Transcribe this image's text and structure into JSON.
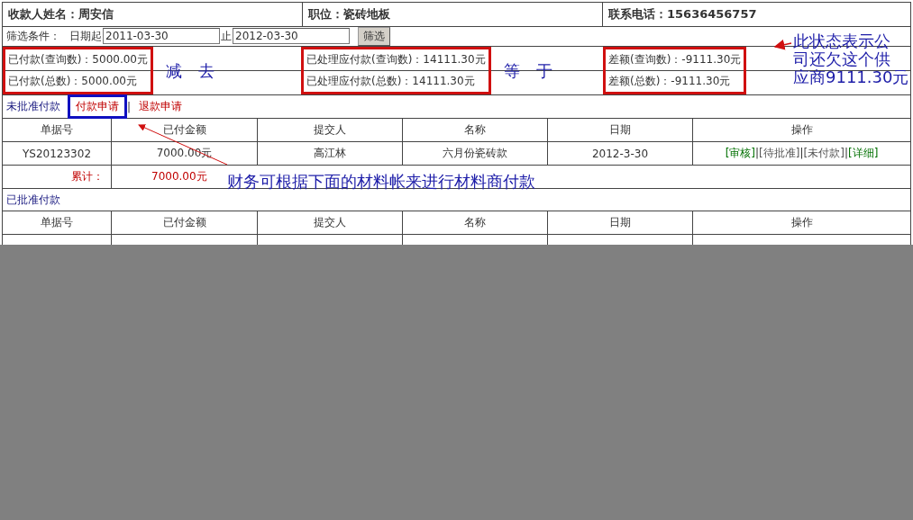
{
  "header": {
    "payee": "收款人姓名：周安信",
    "position": "职位：瓷砖地板",
    "phone": "联系电话：15636456757"
  },
  "filter": {
    "label": "筛选条件：",
    "start_label": "日期起",
    "start_value": "2011-03-30",
    "end_label": "止",
    "end_value": "2012-03-30",
    "button": "筛选"
  },
  "summary": [
    {
      "query": "已付款(查询数)：5000.00元",
      "total": "已付款(总数)：5000.00元",
      "note": "减　去"
    },
    {
      "query": "已处理应付款(查询数)：14111.30元",
      "total": "已处理应付款(总数)：14111.30元",
      "note": "等　于"
    },
    {
      "query": "差额(查询数)：-9111.30元",
      "total": "差额(总数)：-9111.30元"
    }
  ],
  "side_note": [
    "此状态表示公",
    "司还欠这个供",
    "应商9111.30元"
  ],
  "pending": {
    "title": "未批准付款",
    "tabs": [
      {
        "label": "付款申请",
        "selected": true
      },
      {
        "label": "退款申请",
        "selected": false
      }
    ],
    "tab_separator": "|",
    "columns": [
      "单据号",
      "已付金额",
      "提交人",
      "名称",
      "日期",
      "操作"
    ],
    "rows": [
      {
        "cells": [
          "YS20123302",
          "7000.00元",
          "高江林",
          "六月份瓷砖款",
          "2012-3-30"
        ],
        "actions": [
          {
            "label": "审核",
            "kind": "link"
          },
          {
            "label": "待批准",
            "kind": "status"
          },
          {
            "label": "未付款",
            "kind": "status"
          },
          {
            "label": "详细",
            "kind": "link"
          }
        ]
      }
    ],
    "total": {
      "label": "累计：",
      "amount": "7000.00元"
    },
    "note": "财务可根据下面的材料帐来进行材料商付款"
  },
  "approved": {
    "title": "已批准付款",
    "columns": [
      "单据号",
      "已付金额",
      "提交人",
      "名称",
      "日期",
      "操作"
    ]
  },
  "brackets": [
    "[",
    "]"
  ],
  "action_separator": "|"
}
